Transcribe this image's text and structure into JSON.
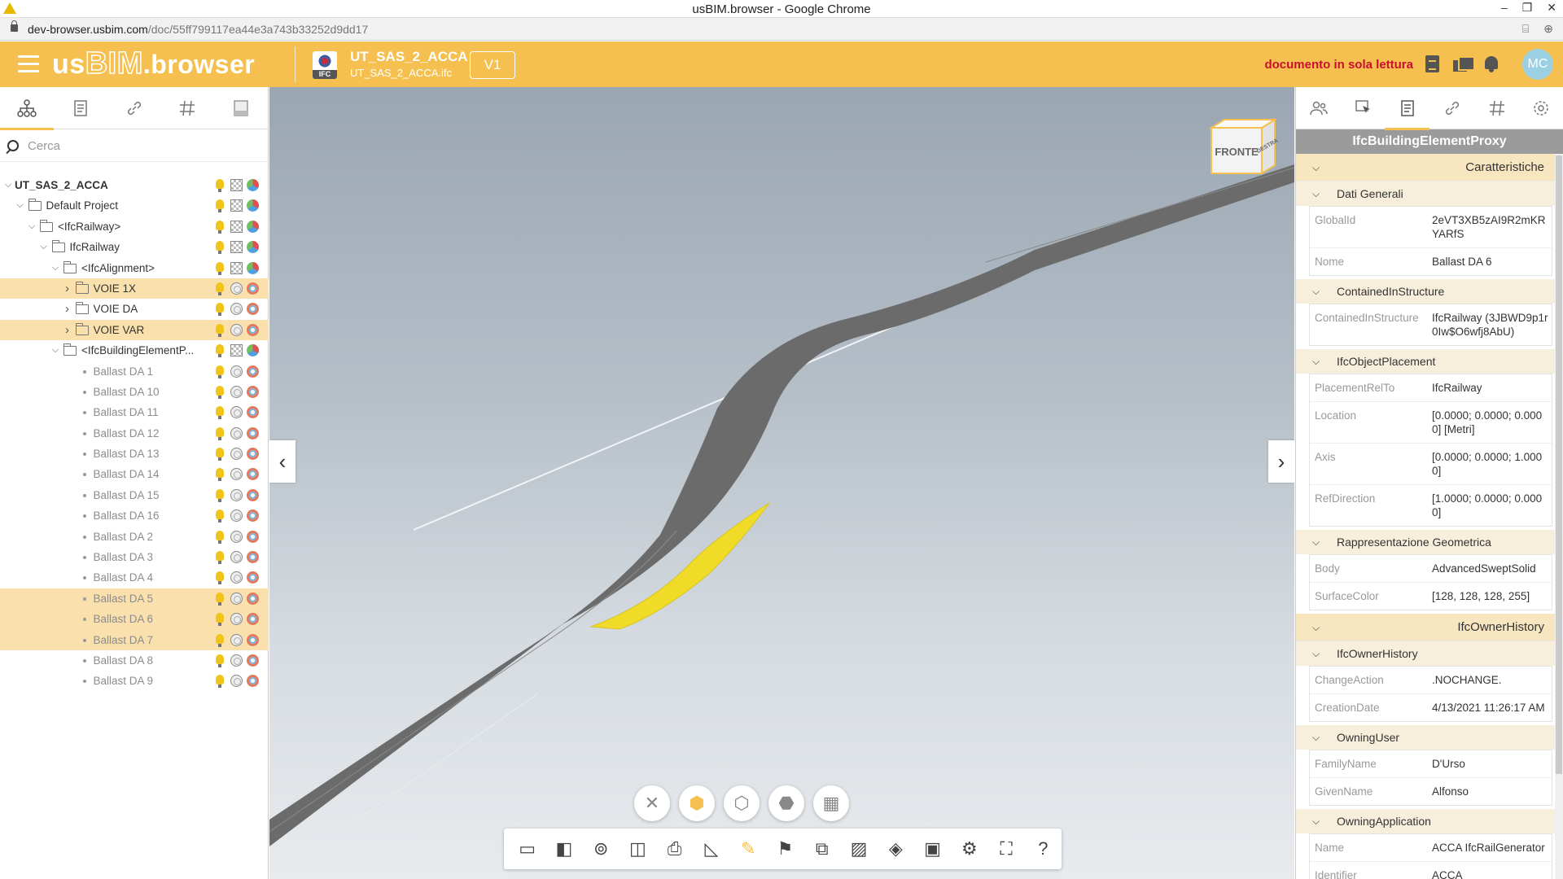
{
  "window": {
    "title": "usBIM.browser - Google Chrome",
    "url_host": "dev-browser.usbim.com",
    "url_path": "/doc/55ff799117ea44e3a743b33252d9dd17"
  },
  "header": {
    "logo_us": "us",
    "logo_bim": "BIM",
    "logo_browser": ".browser",
    "doc_title": "UT_SAS_2_ACCA",
    "doc_file": "UT_SAS_2_ACCA.ifc",
    "ifc_label": "IFC",
    "version": "V1",
    "readonly_notice": "documento in sola lettura",
    "avatar_initials": "MC",
    "accent_color": "#f5c04f",
    "notice_color": "#c8102e"
  },
  "left_panel": {
    "tabs": [
      {
        "name": "tree",
        "icon": "hierarchy-icon"
      },
      {
        "name": "documents",
        "icon": "document-icon"
      },
      {
        "name": "links",
        "icon": "link-icon"
      },
      {
        "name": "hash",
        "icon": "hash-icon"
      },
      {
        "name": "storage",
        "icon": "drive-icon"
      }
    ],
    "search_placeholder": "Cerca",
    "tree": [
      {
        "label": "UT_SAS_2_ACCA",
        "level": 0,
        "type": "root",
        "expanded": true,
        "highlight": false
      },
      {
        "label": "Default Project",
        "level": 1,
        "type": "folder",
        "expanded": true,
        "highlight": false
      },
      {
        "label": "<IfcRailway>",
        "level": 2,
        "type": "folder",
        "expanded": true,
        "highlight": false
      },
      {
        "label": "IfcRailway",
        "level": 3,
        "type": "folder",
        "expanded": true,
        "highlight": false
      },
      {
        "label": "<IfcAlignment>",
        "level": 4,
        "type": "folder",
        "expanded": true,
        "highlight": false
      },
      {
        "label": "VOIE 1X",
        "level": 5,
        "type": "folder",
        "expanded": false,
        "highlight": true
      },
      {
        "label": "VOIE DA",
        "level": 5,
        "type": "folder",
        "expanded": false,
        "highlight": false
      },
      {
        "label": "VOIE VAR",
        "level": 5,
        "type": "folder",
        "expanded": false,
        "highlight": true
      },
      {
        "label": "<IfcBuildingElementP...",
        "level": 4,
        "type": "folder",
        "expanded": true,
        "highlight": false
      },
      {
        "label": "Ballast DA 1",
        "level": 5,
        "type": "leaf",
        "highlight": false
      },
      {
        "label": "Ballast DA 10",
        "level": 5,
        "type": "leaf",
        "highlight": false
      },
      {
        "label": "Ballast DA 11",
        "level": 5,
        "type": "leaf",
        "highlight": false
      },
      {
        "label": "Ballast DA 12",
        "level": 5,
        "type": "leaf",
        "highlight": false
      },
      {
        "label": "Ballast DA 13",
        "level": 5,
        "type": "leaf",
        "highlight": false
      },
      {
        "label": "Ballast DA 14",
        "level": 5,
        "type": "leaf",
        "highlight": false
      },
      {
        "label": "Ballast DA 15",
        "level": 5,
        "type": "leaf",
        "highlight": false
      },
      {
        "label": "Ballast DA 16",
        "level": 5,
        "type": "leaf",
        "highlight": false
      },
      {
        "label": "Ballast DA 2",
        "level": 5,
        "type": "leaf",
        "highlight": false
      },
      {
        "label": "Ballast DA 3",
        "level": 5,
        "type": "leaf",
        "highlight": false
      },
      {
        "label": "Ballast DA 4",
        "level": 5,
        "type": "leaf",
        "highlight": false
      },
      {
        "label": "Ballast DA 5",
        "level": 5,
        "type": "leaf",
        "highlight": true
      },
      {
        "label": "Ballast DA 6",
        "level": 5,
        "type": "leaf",
        "highlight": true
      },
      {
        "label": "Ballast DA 7",
        "level": 5,
        "type": "leaf",
        "highlight": true
      },
      {
        "label": "Ballast DA 8",
        "level": 5,
        "type": "leaf",
        "highlight": false
      },
      {
        "label": "Ballast DA 9",
        "level": 5,
        "type": "leaf",
        "highlight": false
      }
    ]
  },
  "viewer": {
    "navcube_front": "FRONTE",
    "navcube_right": "DESTRA",
    "circle_tools": [
      {
        "name": "close",
        "glyph": "✕",
        "active": false
      },
      {
        "name": "solid-view",
        "glyph": "⬢",
        "active": true
      },
      {
        "name": "wireframe-view",
        "glyph": "⬡",
        "active": false
      },
      {
        "name": "hidden-lines-view",
        "glyph": "⬣",
        "active": false
      },
      {
        "name": "grid-view",
        "glyph": "▦",
        "active": false
      }
    ],
    "toolbar": [
      {
        "name": "camera",
        "glyph": "▭"
      },
      {
        "name": "box",
        "glyph": "◧"
      },
      {
        "name": "antenna",
        "glyph": "⊚"
      },
      {
        "name": "section-box",
        "glyph": "◫"
      },
      {
        "name": "document-pin",
        "glyph": "⎙"
      },
      {
        "name": "measure",
        "glyph": "◺"
      },
      {
        "name": "brush",
        "glyph": "✎"
      },
      {
        "name": "flag",
        "glyph": "⚑"
      },
      {
        "name": "compare",
        "glyph": "⧉"
      },
      {
        "name": "cube-hatch",
        "glyph": "▨"
      },
      {
        "name": "layers-cube",
        "glyph": "◈"
      },
      {
        "name": "monitor",
        "glyph": "▣"
      },
      {
        "name": "settings",
        "glyph": "⚙"
      },
      {
        "name": "fullscreen",
        "glyph": "⛶"
      },
      {
        "name": "help",
        "glyph": "?"
      }
    ],
    "track_color": "#6b6b6b",
    "selection_color": "#f0dc28"
  },
  "right_panel": {
    "tabs": [
      {
        "name": "users",
        "icon": "users-icon"
      },
      {
        "name": "select",
        "icon": "cursor-icon"
      },
      {
        "name": "properties",
        "icon": "document-icon"
      },
      {
        "name": "links",
        "icon": "link-icon"
      },
      {
        "name": "hash",
        "icon": "hash-icon"
      },
      {
        "name": "settings",
        "icon": "gear-icon"
      }
    ],
    "title": "IfcBuildingElementProxy",
    "sections": [
      {
        "title": "Caratteristiche",
        "groups": [
          {
            "title": "Dati Generali",
            "rows": [
              {
                "key": "GlobalId",
                "value": "2eVT3XB5zAI9R2mKRYARfS"
              },
              {
                "key": "Nome",
                "value": "Ballast DA 6"
              }
            ]
          },
          {
            "title": "ContainedInStructure",
            "rows": [
              {
                "key": "ContainedInStructure",
                "value": "IfcRailway (3JBWD9p1r0Iw$O6wfj8AbU)"
              }
            ]
          },
          {
            "title": "IfcObjectPlacement",
            "rows": [
              {
                "key": "PlacementRelTo",
                "value": "IfcRailway"
              },
              {
                "key": "Location",
                "value": "[0.0000; 0.0000; 0.0000] [Metri]"
              },
              {
                "key": "Axis",
                "value": "[0.0000; 0.0000; 1.0000]"
              },
              {
                "key": "RefDirection",
                "value": "[1.0000; 0.0000; 0.0000]"
              }
            ]
          },
          {
            "title": "Rappresentazione Geometrica",
            "rows": [
              {
                "key": "Body",
                "value": "AdvancedSweptSolid"
              },
              {
                "key": "SurfaceColor",
                "value": "[128, 128, 128, 255]"
              }
            ]
          }
        ]
      },
      {
        "title": "IfcOwnerHistory",
        "groups": [
          {
            "title": "IfcOwnerHistory",
            "rows": [
              {
                "key": "ChangeAction",
                "value": ".NOCHANGE."
              },
              {
                "key": "CreationDate",
                "value": "4/13/2021 11:26:17 AM"
              }
            ]
          },
          {
            "title": "OwningUser",
            "rows": [
              {
                "key": "FamilyName",
                "value": "D'Urso"
              },
              {
                "key": "GivenName",
                "value": "Alfonso"
              }
            ]
          },
          {
            "title": "OwningApplication",
            "rows": [
              {
                "key": "Name",
                "value": "ACCA IfcRailGenerator"
              },
              {
                "key": "Identifier",
                "value": "ACCA"
              }
            ]
          }
        ]
      }
    ]
  }
}
